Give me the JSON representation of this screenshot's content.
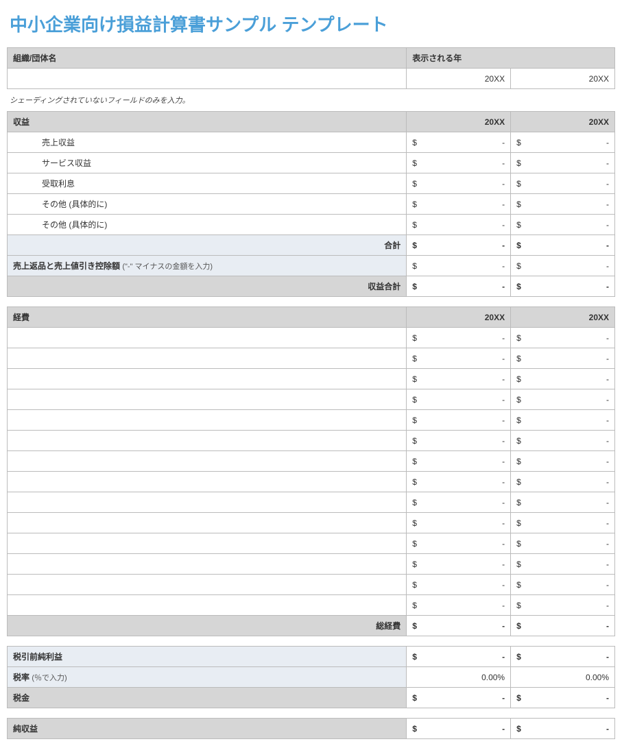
{
  "title": "中小企業向け損益計算書サンプル テンプレート",
  "org_header": {
    "label": "組織/団体名",
    "year_label": "表示される年",
    "year1": "20XX",
    "year2": "20XX"
  },
  "note": "シェーディングされていないフィールドのみを入力。",
  "revenue": {
    "header": "収益",
    "year1": "20XX",
    "year2": "20XX",
    "items": [
      {
        "label": "売上収益"
      },
      {
        "label": "サービス収益"
      },
      {
        "label": "受取利息"
      },
      {
        "label": "その他 (具体的に)"
      },
      {
        "label": "その他 (具体的に)"
      }
    ],
    "subtotal_label": "合計",
    "returns_label": "売上返品と売上値引き控除額",
    "returns_note": "(\"-\" マイナスの金額を入力)",
    "total_label": "収益合計"
  },
  "expenses": {
    "header": "経費",
    "year1": "20XX",
    "year2": "20XX",
    "row_count": 14,
    "subtotal_label": "総経費"
  },
  "summary": {
    "pretax_label": "税引前純利益",
    "taxrate_label": "税率",
    "taxrate_note": "(％で入力)",
    "taxrate_val1": "0.00%",
    "taxrate_val2": "0.00%",
    "tax_label": "税金",
    "net_label": "純収益"
  },
  "money": {
    "sym": "$",
    "dash": "-"
  }
}
